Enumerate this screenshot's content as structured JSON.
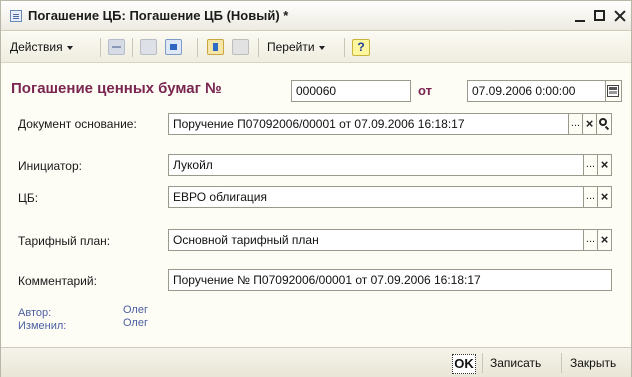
{
  "window": {
    "title": "Погашение ЦБ: Погашение ЦБ (Новый) *"
  },
  "toolbar": {
    "actions_label": "Действия",
    "goto_label": "Перейти",
    "help_label": "?"
  },
  "form": {
    "heading": "Погашение ценных бумаг №",
    "number": "000060",
    "date_prefix": "от",
    "date": "07.09.2006  0:00:00",
    "basis_label": "Документ основание:",
    "basis_value": "Поручение П07092006/00001 от 07.09.2006 16:18:17",
    "initiator_label": "Инициатор:",
    "initiator_value": "Лукойл",
    "security_label": "ЦБ:",
    "security_value": "ЕВРО облигация",
    "tariff_label": "Тарифный план:",
    "tariff_value": "Основной тарифный план",
    "comment_label": "Комментарий:",
    "comment_value": "Поручение № П07092006/00001 от 07.09.2006 16:18:17",
    "author_label": "Автор:",
    "author_value": "Олег",
    "modified_label": "Изменил:",
    "modified_value": "Олег",
    "select_button": "...",
    "clear_button": "×"
  },
  "bottom": {
    "ok_label": "OK",
    "save_label": "Записать",
    "close_label": "Закрыть"
  },
  "colors": {
    "heading": "#7a2650",
    "meta": "#4a5fa0",
    "background": "#fdfcf5"
  }
}
